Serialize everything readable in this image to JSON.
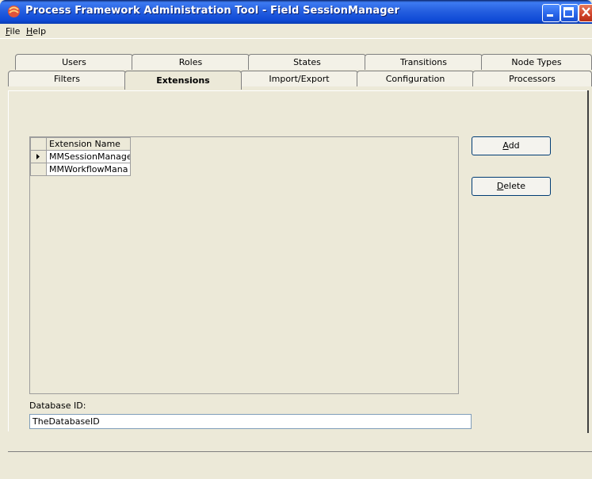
{
  "window": {
    "title": "Process Framework Administration Tool - Field SessionManager"
  },
  "menu": {
    "file": {
      "first": "F",
      "rest": "ile"
    },
    "help": {
      "first": "H",
      "rest": "elp"
    }
  },
  "tabs": {
    "back_row": [
      "Users",
      "Roles",
      "States",
      "Transitions",
      "Node Types"
    ],
    "front_row": [
      "Filters",
      "Extensions",
      "Import/Export",
      "Configuration",
      "Processors"
    ],
    "active": "Extensions"
  },
  "extensions": {
    "column_header": "Extension Name",
    "rows": [
      "MMSessionManage",
      "MMWorkflowMana"
    ],
    "selected_index": 0
  },
  "buttons": {
    "add": {
      "first": "A",
      "rest": "dd"
    },
    "delete": {
      "first": "D",
      "rest": "elete"
    }
  },
  "database": {
    "label": "Database ID:",
    "value": "TheDatabaseID"
  },
  "icons": {
    "app": "app-icon",
    "minimize": "minimize-icon",
    "maximize": "maximize-icon",
    "close": "close-icon",
    "row_pointer": "row-pointer-icon"
  }
}
